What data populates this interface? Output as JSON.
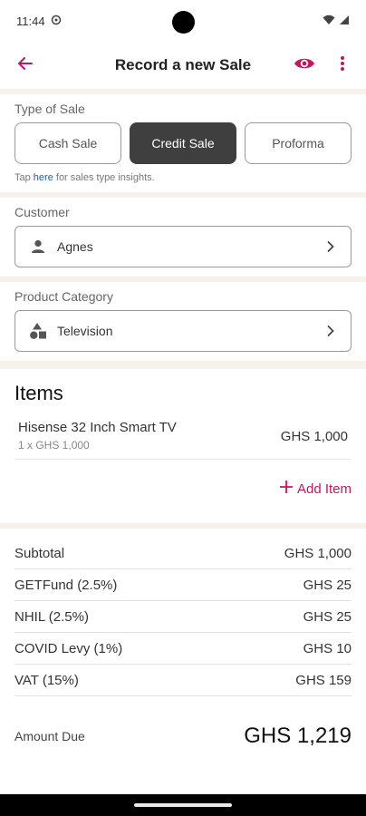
{
  "status_bar": {
    "time": "11:44"
  },
  "app_bar": {
    "title": "Record a new Sale"
  },
  "colors": {
    "accent": "#c2185b",
    "selected": "#3f3f3f",
    "band": "#f6f1ea"
  },
  "type_of_sale": {
    "label": "Type of Sale",
    "options": [
      "Cash Sale",
      "Credit Sale",
      "Proforma"
    ],
    "selected": "Credit Sale",
    "hint_prefix": "Tap ",
    "hint_link": "here",
    "hint_suffix": " for sales type insights."
  },
  "customer": {
    "label": "Customer",
    "value": "Agnes",
    "icon": "person-icon"
  },
  "product_category": {
    "label": "Product Category",
    "value": "Television",
    "icon": "shapes-icon"
  },
  "items": {
    "title": "Items",
    "list": [
      {
        "name": "Hisense 32 Inch Smart TV",
        "qty_price": "1 x GHS 1,000",
        "total": "GHS 1,000"
      }
    ],
    "add_label": "Add Item"
  },
  "totals": [
    {
      "label": "Subtotal",
      "value": "GHS 1,000"
    },
    {
      "label": "GETFund (2.5%)",
      "value": "GHS 25"
    },
    {
      "label": "NHIL (2.5%)",
      "value": "GHS 25"
    },
    {
      "label": "COVID Levy (1%)",
      "value": "GHS 10"
    },
    {
      "label": "VAT (15%)",
      "value": "GHS 159"
    }
  ],
  "amount_due": {
    "label": "Amount Due",
    "value": "GHS 1,219"
  }
}
